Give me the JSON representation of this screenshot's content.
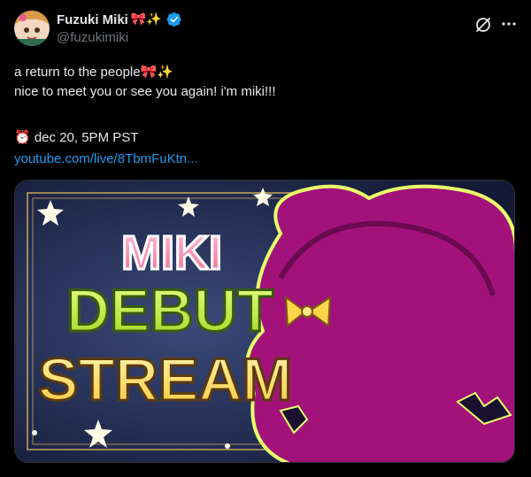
{
  "author": {
    "display_name": "Fuzuki Miki",
    "name_emojis": "🎀✨",
    "handle": "@fuzukimiki"
  },
  "post": {
    "line1": "a return to the people🎀✨",
    "line2": "nice to meet you or see you again! i'm miki!!!",
    "line3": "⏰ dec 20, 5PM PST",
    "link": "youtube.com/live/8TbmFuKtn..."
  },
  "media": {
    "word1": "MIKI",
    "word2": "DEBUT",
    "word3": "STREAM"
  },
  "colors": {
    "accent": "#1d9bf0",
    "verified": "#1d9bf0",
    "secondary_text": "#71767b",
    "silhouette": "#a3127a",
    "banner_bg": "#1e2a52"
  },
  "icons": {
    "verified": "verified-badge-icon",
    "grok": "grok-icon",
    "more": "more-icon"
  }
}
